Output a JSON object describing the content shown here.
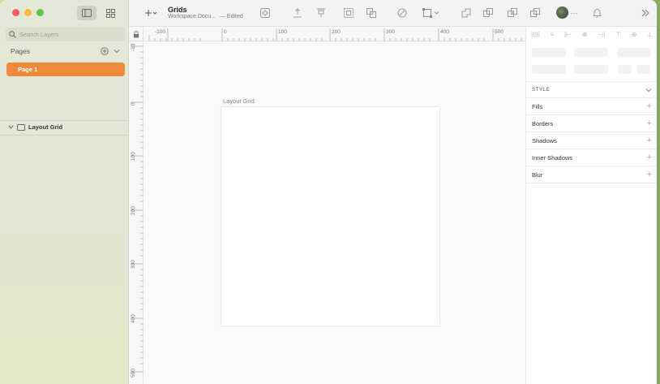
{
  "document": {
    "title": "Grids",
    "subtitle": "Workspace Docu...",
    "status": "— Edited"
  },
  "sidebar": {
    "search_placeholder": "Search Layers",
    "pages_label": "Pages",
    "pages": [
      {
        "label": "Page 1"
      }
    ],
    "layers": [
      {
        "label": "Layout Grid"
      }
    ]
  },
  "canvas": {
    "artboard_label": "Layout Grid",
    "ruler_top_labels": [
      "-100",
      "0",
      "100",
      "200",
      "300",
      "400",
      "500"
    ],
    "ruler_left_labels": [
      "-10",
      "0",
      "100",
      "200",
      "300",
      "400",
      "500"
    ]
  },
  "inspector": {
    "style_label": "STYLE",
    "sections": [
      {
        "label": "Fills"
      },
      {
        "label": "Borders"
      },
      {
        "label": "Shadows"
      },
      {
        "label": "Inner Shadows"
      },
      {
        "label": "Blur"
      }
    ]
  },
  "colors": {
    "accent": "#ee8a3c",
    "sidebar_bg": "#e3e7d3"
  }
}
